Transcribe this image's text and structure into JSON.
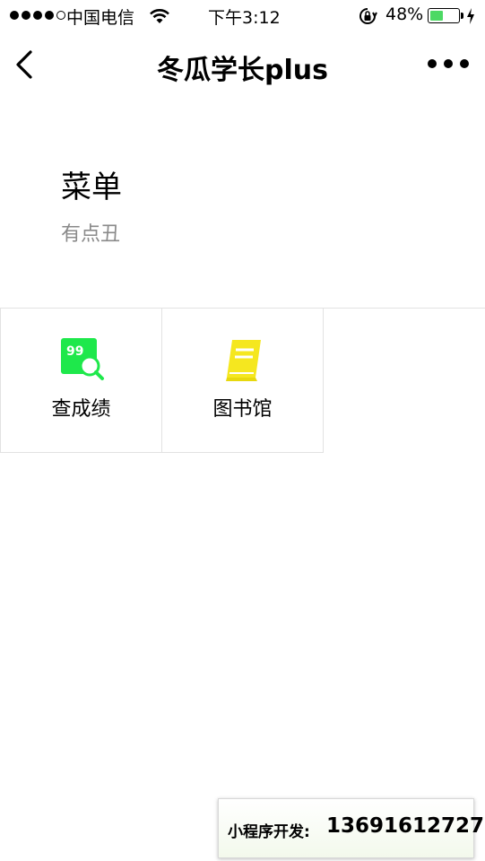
{
  "status_bar": {
    "signal_bars": 4,
    "signal_total": 5,
    "carrier": "中国电信",
    "time": "下午3:12",
    "battery_percent": "48%",
    "battery_level": 0.48,
    "battery_color": "#4cd964"
  },
  "nav": {
    "title": "冬瓜学长plus"
  },
  "header": {
    "title": "菜单",
    "subtitle": "有点丑"
  },
  "menu_items": [
    {
      "label": "查成绩",
      "icon": "score-search-icon",
      "icon_text": "99",
      "color": "#1ee84b"
    },
    {
      "label": "图书馆",
      "icon": "book-icon",
      "color": "#f5e71f"
    }
  ],
  "dev_badge": {
    "label": "小程序开发:",
    "phone": "13691612727"
  }
}
